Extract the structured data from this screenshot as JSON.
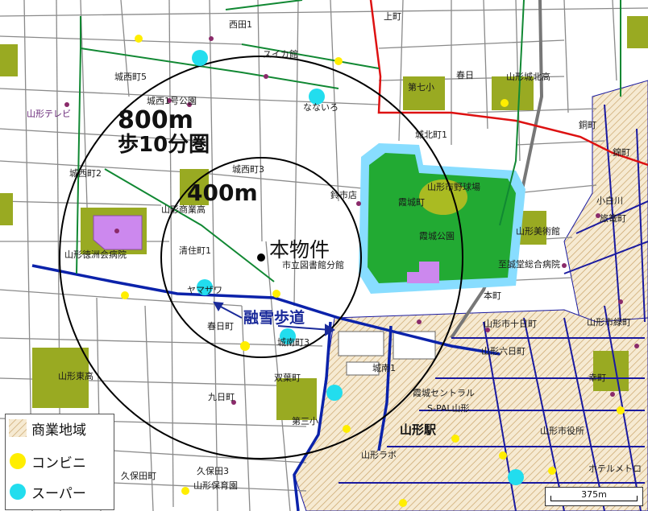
{
  "map": {
    "center_label": "本物件",
    "ring_400": "400m",
    "ring_800": "800m",
    "walk_label": "歩10分圏",
    "snow_path_label": "融雪歩道",
    "station_label": "山形駅",
    "labels": [
      "城西町5",
      "城西1号公園",
      "山形テレビ",
      "西田1",
      "スイカ館",
      "なないろ",
      "第七小",
      "春日",
      "山形城北高",
      "城北町1",
      "銅町",
      "城西町3",
      "鈴市店",
      "霞城町",
      "山形市野球場",
      "霞城公園",
      "山形美術館",
      "城西町2",
      "山形商業高",
      "清住町1",
      "山形徳洲会病院",
      "市立図書館分館",
      "至誠堂総合病院",
      "本町",
      "ヤマザワ",
      "春日町",
      "城南町3",
      "山形市緑町",
      "旅篭町",
      "双葉町",
      "九日町",
      "久保田町",
      "第三小",
      "山形東高",
      "山形六日町",
      "城南1",
      "霞城セントラル",
      "S-PAL山形",
      "山形ラボ",
      "山形市役所",
      "山形保育園",
      "山形市十日町",
      "幸町",
      "久保田3",
      "ホテルメトロ",
      "小白川",
      "上町",
      "錦町"
    ]
  },
  "legend": {
    "items": [
      {
        "label": "商業地域",
        "icon": "commercial-zone-hatch-icon"
      },
      {
        "label": "コンビニ",
        "icon": "yellow-dot-icon",
        "color": "#ffee00"
      },
      {
        "label": "スーパー",
        "icon": "cyan-dot-icon",
        "color": "#22ddee"
      }
    ]
  },
  "scale_bar": {
    "label": "375m"
  },
  "colors": {
    "park": "#22aa33",
    "moat": "#88ddff",
    "green_area": "#99aa22",
    "commercial": "#f2e0c0",
    "main_road": "#0b22aa",
    "rail_red": "#dd1111",
    "rail_green": "#118833",
    "convenience": "#ffee00",
    "supermarket": "#22ddee"
  }
}
